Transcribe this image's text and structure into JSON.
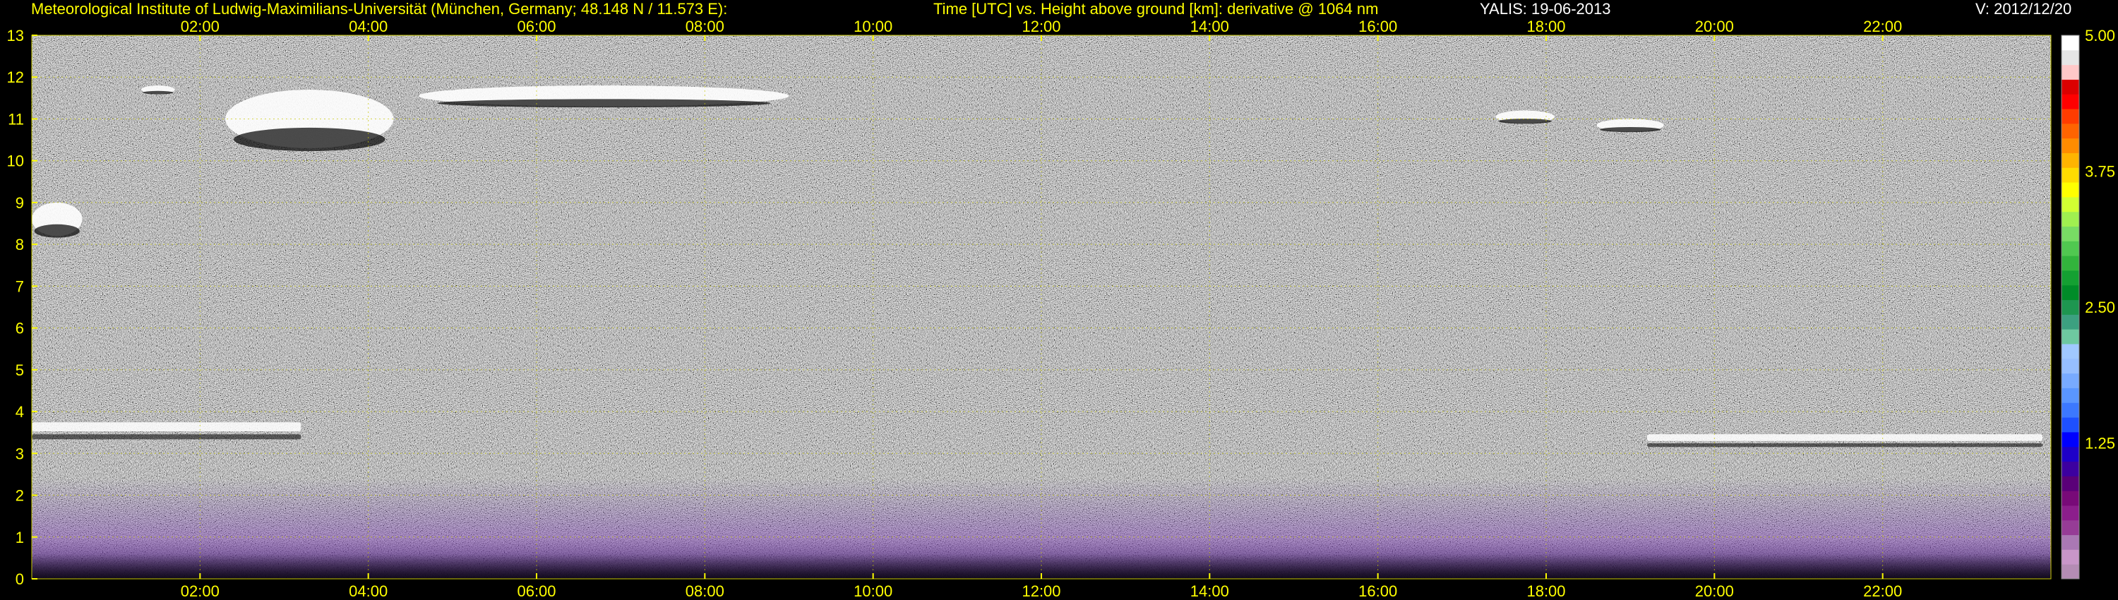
{
  "header": {
    "institute": "Meteorological Institute of Ludwig-Maximilians-Universität (München, Germany; 48.148 N / 11.573 E):",
    "description": "Time [UTC] vs. Height above ground [km]: derivative @ 1064 nm",
    "instrument_date": "YALIS: 19-06-2013",
    "version": "V: 2012/12/20"
  },
  "chart_data": {
    "type": "heatmap",
    "title": "Time [UTC] vs. Height above ground [km]: derivative @ 1064 nm",
    "xlabel": "Time [UTC]",
    "ylabel": "Height above ground [km]",
    "xlim": [
      0,
      24
    ],
    "ylim": [
      0,
      13
    ],
    "x_ticks": [
      "02:00",
      "04:00",
      "06:00",
      "08:00",
      "10:00",
      "12:00",
      "14:00",
      "16:00",
      "18:00",
      "20:00",
      "22:00"
    ],
    "x_tick_hours": [
      2,
      4,
      6,
      8,
      10,
      12,
      14,
      16,
      18,
      20,
      22
    ],
    "y_ticks": [
      0,
      1,
      2,
      3,
      4,
      5,
      6,
      7,
      8,
      9,
      10,
      11,
      12,
      13
    ],
    "grid": true,
    "colorbar": {
      "range": [
        0,
        5
      ],
      "labels": [
        "5.00",
        "3.75",
        "2.50",
        "1.25"
      ],
      "label_values": [
        5.0,
        3.75,
        2.5,
        1.25
      ],
      "colors_bottom_to_top": [
        "#b48cb4",
        "#c896c8",
        "#aa78b4",
        "#963c96",
        "#8c1e8c",
        "#780a78",
        "#5a0078",
        "#3c00a0",
        "#1e00c8",
        "#0000ff",
        "#1e50ff",
        "#3c78ff",
        "#5a96ff",
        "#78aaff",
        "#96beff",
        "#a0c8ff",
        "#6ec8a0",
        "#3ca080",
        "#1e9650",
        "#008c28",
        "#14a032",
        "#32b43c",
        "#50c850",
        "#78dc64",
        "#a0f050",
        "#d2ff32",
        "#ffff00",
        "#ffdc00",
        "#ffb400",
        "#ff8c00",
        "#ff6400",
        "#ff3c00",
        "#ff0000",
        "#dc0000",
        "#ffc8c8",
        "#e6e6e6",
        "#ffffff"
      ]
    },
    "features": [
      {
        "kind": "cloud",
        "x": [
          1.3,
          1.7
        ],
        "y": [
          11.6,
          11.8
        ]
      },
      {
        "kind": "cloud",
        "x": [
          2.3,
          4.3
        ],
        "y": [
          10.3,
          11.7
        ]
      },
      {
        "kind": "cloud",
        "x": [
          4.6,
          9.0
        ],
        "y": [
          11.3,
          11.8
        ]
      },
      {
        "kind": "cloud",
        "x": [
          0.0,
          0.6
        ],
        "y": [
          8.2,
          9.0
        ]
      },
      {
        "kind": "cloud",
        "x": [
          17.4,
          18.1
        ],
        "y": [
          10.9,
          11.2
        ]
      },
      {
        "kind": "cloud",
        "x": [
          18.6,
          19.4
        ],
        "y": [
          10.7,
          11.0
        ]
      },
      {
        "kind": "layer",
        "x": [
          0.0,
          3.2
        ],
        "y": [
          3.0,
          4.2
        ]
      },
      {
        "kind": "layer",
        "x": [
          19.2,
          23.9
        ],
        "y": [
          2.9,
          3.8
        ]
      },
      {
        "kind": "boundary_layer",
        "x": [
          0.0,
          24.0
        ],
        "y": [
          0.0,
          2.4
        ]
      }
    ]
  }
}
